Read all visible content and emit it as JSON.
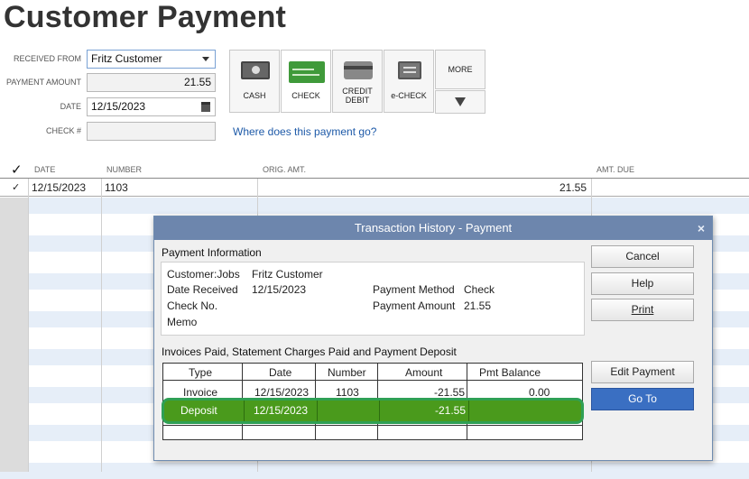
{
  "page": {
    "title": "Customer Payment"
  },
  "form": {
    "received_from_label": "RECEIVED FROM",
    "received_from_value": "Fritz Customer",
    "payment_amount_label": "PAYMENT AMOUNT",
    "payment_amount_value": "21.55",
    "date_label": "DATE",
    "date_value": "12/15/2023",
    "check_label": "CHECK #",
    "check_value": ""
  },
  "payment_methods": [
    {
      "label": "CASH",
      "icon": "cash-icon"
    },
    {
      "label": "CHECK",
      "icon": "check-icon",
      "selected": true
    },
    {
      "label": "CREDIT\nDEBIT",
      "icon": "credit-card-icon"
    },
    {
      "label": "e-CHECK",
      "icon": "echeck-icon"
    }
  ],
  "more_label": "MORE",
  "link_text": "Where does this payment go?",
  "table": {
    "headers": {
      "check": "✓",
      "date": "DATE",
      "number": "NUMBER",
      "orig_amt": "ORIG. AMT.",
      "amt_due": "AMT. DUE"
    },
    "rows": [
      {
        "checked": "✓",
        "date": "12/15/2023",
        "number": "1103",
        "orig_amt": "21.55",
        "amt_due": ""
      }
    ]
  },
  "dialog": {
    "title": "Transaction History - Payment",
    "close": "×",
    "payment_info_label": "Payment Information",
    "info": {
      "customer_label": "Customer:Jobs",
      "customer_value": "Fritz Customer",
      "date_label": "Date Received",
      "date_value": "12/15/2023",
      "check_label": "Check No.",
      "memo_label": "Memo",
      "method_label": "Payment Method",
      "method_value": "Check",
      "amount_label": "Payment Amount",
      "amount_value": "21.55"
    },
    "invoices_label": "Invoices Paid, Statement Charges Paid and Payment Deposit",
    "columns": {
      "type": "Type",
      "date": "Date",
      "number": "Number",
      "amount": "Amount",
      "balance": "Pmt Balance"
    },
    "rows": [
      {
        "type": "Invoice",
        "date": "12/15/2023",
        "number": "1103",
        "amount": "-21.55",
        "balance": "0.00"
      },
      {
        "type": "Deposit",
        "date": "12/15/2023",
        "number": "",
        "amount": "-21.55",
        "balance": ""
      }
    ],
    "buttons": {
      "cancel": "Cancel",
      "help": "Help",
      "print": "Print",
      "edit_payment": "Edit Payment",
      "go_to": "Go To"
    }
  },
  "colors": {
    "title_bar": "#6d86ad",
    "selected_row": "#4a9a1c",
    "highlight_border": "#2fa055",
    "go_to": "#3a6fc2"
  }
}
